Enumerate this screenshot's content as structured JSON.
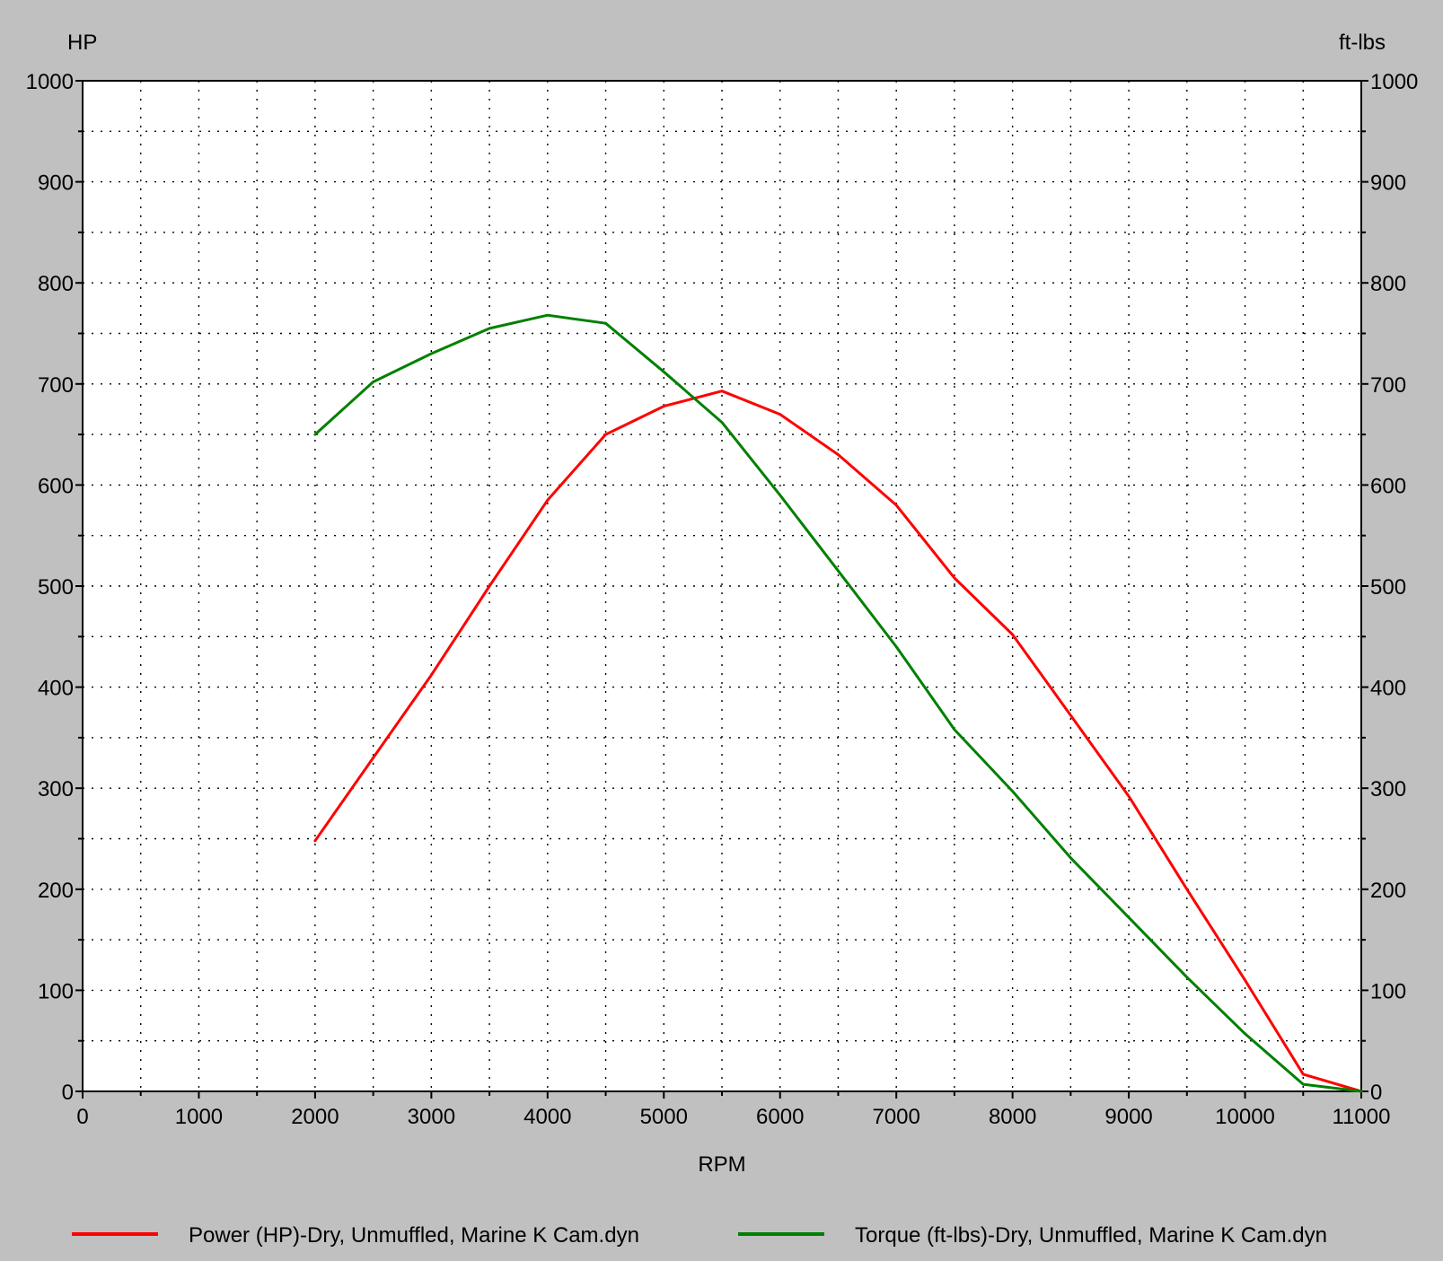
{
  "chart_data": {
    "type": "line",
    "xlabel": "RPM",
    "ylabel_left": "HP",
    "ylabel_right": "ft-lbs",
    "xlim": [
      0,
      11000
    ],
    "ylim_left": [
      0,
      1000
    ],
    "ylim_right": [
      0,
      1000
    ],
    "x_ticks": [
      "0",
      "1000",
      "2000",
      "3000",
      "4000",
      "5000",
      "6000",
      "7000",
      "8000",
      "9000",
      "10000",
      "11000"
    ],
    "y_ticks": [
      "0",
      "100",
      "200",
      "300",
      "400",
      "500",
      "600",
      "700",
      "800",
      "900",
      "1000"
    ],
    "grid": true,
    "legend_position": "bottom",
    "series": [
      {
        "name": "Power (HP)-Dry, Unmuffled, Marine K Cam.dyn",
        "color": "#ff0000",
        "axis": "left",
        "x": [
          2000,
          2500,
          3000,
          3500,
          4000,
          4500,
          5000,
          5500,
          6000,
          6500,
          7000,
          7500,
          8000,
          8500,
          9000,
          9500,
          10000,
          10500,
          11000
        ],
        "y": [
          248,
          330,
          412,
          500,
          585,
          650,
          678,
          693,
          670,
          630,
          580,
          508,
          452,
          372,
          292,
          200,
          110,
          17,
          0
        ]
      },
      {
        "name": "Torque (ft-lbs)-Dry, Unmuffled, Marine K Cam.dyn",
        "color": "#008000",
        "axis": "right",
        "x": [
          2000,
          2500,
          3000,
          3500,
          4000,
          4500,
          5000,
          5500,
          6000,
          6500,
          7000,
          7500,
          8000,
          8500,
          9000,
          9500,
          10000,
          10500,
          11000
        ],
        "y": [
          650,
          702,
          730,
          755,
          768,
          760,
          712,
          662,
          590,
          515,
          440,
          358,
          297,
          231,
          172,
          113,
          57,
          7,
          0
        ]
      }
    ]
  }
}
